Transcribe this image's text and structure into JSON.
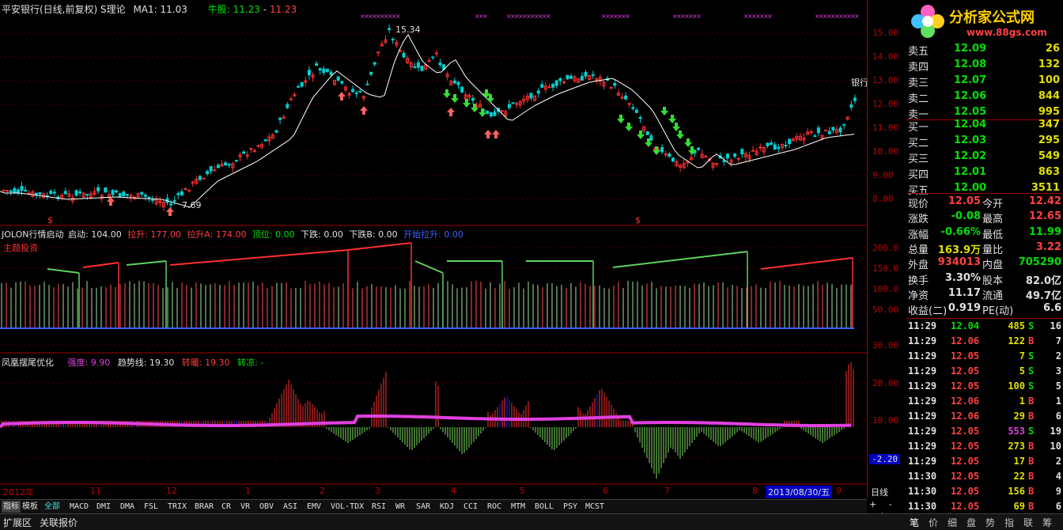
{
  "header": {
    "title": "平安银行(日线,前复权) S理论",
    "ma": "MA1: 11.03",
    "bull_label": "牛股:",
    "bull_v1": "11.23",
    "bull_v2": "11.23"
  },
  "logo": {
    "name": "分析家公式网",
    "url": "www.88gs.com"
  },
  "main_chart": {
    "axis_ticks": [
      "15.00",
      "14.00",
      "13.00",
      "12.00",
      "11.00",
      "10.00",
      "9.00",
      "8.00"
    ],
    "high_label": "15.34",
    "low_label": "7.69",
    "stock_tag": "银行",
    "marker": "$"
  },
  "indicator1": {
    "name": "JOLON行情启动",
    "f1": "启动: 104.00",
    "f2": "拉升: 177.00",
    "f3": "拉升A: 174.00",
    "f4": "顶位: 0.00",
    "f5": "下跌: 0.00",
    "f6": "下跌B: 0.00",
    "f7": "开始拉升: 0.00",
    "sub_label": "主题投资",
    "axis_ticks": [
      "200.0",
      "150.0",
      "100.0",
      "50.00"
    ]
  },
  "indicator2": {
    "name": "凤凰摆尾优化",
    "f1": "强度: 9.90",
    "f2": "趋势线: 19.30",
    "f3": "转暖: 19.30",
    "f4": "转凉: -",
    "axis_ticks": [
      "30.00",
      "20.00",
      "10.00"
    ],
    "current": "-2.20"
  },
  "time_axis": {
    "labels": [
      "2012年",
      "11",
      "12",
      "1",
      "2",
      "3",
      "4",
      "5",
      "6",
      "7",
      "8",
      "9"
    ],
    "date_highlight": "2013/08/30/五",
    "period": "日线"
  },
  "tabs": [
    "指标",
    "模板",
    "全部",
    "MACD",
    "DMI",
    "DMA",
    "FSL",
    "TRIX",
    "BRAR",
    "CR",
    "VR",
    "OBV",
    "ASI",
    "EMV",
    "VOL-TDX",
    "RSI",
    "WR",
    "SAR",
    "KDJ",
    "CCI",
    "ROC",
    "MTM",
    "BOLL",
    "PSY",
    "MCST"
  ],
  "bottom_left": [
    "扩展区",
    "关联报价"
  ],
  "bottom_right": [
    "笔",
    "价",
    "细",
    "盘",
    "势",
    "指",
    "联",
    "筹"
  ],
  "order_book": {
    "asks": [
      {
        "label": "卖五",
        "price": "12.09",
        "vol": "26"
      },
      {
        "label": "卖四",
        "price": "12.08",
        "vol": "132"
      },
      {
        "label": "卖三",
        "price": "12.07",
        "vol": "100"
      },
      {
        "label": "卖二",
        "price": "12.06",
        "vol": "844"
      },
      {
        "label": "卖一",
        "price": "12.05",
        "vol": "995"
      }
    ],
    "bids": [
      {
        "label": "买一",
        "price": "12.04",
        "vol": "347"
      },
      {
        "label": "买二",
        "price": "12.03",
        "vol": "295"
      },
      {
        "label": "买三",
        "price": "12.02",
        "vol": "549"
      },
      {
        "label": "买四",
        "price": "12.01",
        "vol": "863"
      },
      {
        "label": "买五",
        "price": "12.00",
        "vol": "3511"
      }
    ]
  },
  "quote": {
    "rows": [
      {
        "l1": "现价",
        "v1": "12.05",
        "c1": "#ff4040",
        "l2": "今开",
        "v2": "12.42",
        "c2": "#ff4040"
      },
      {
        "l1": "涨跌",
        "v1": "-0.08",
        "c1": "#00e000",
        "l2": "最高",
        "v2": "12.65",
        "c2": "#ff4040"
      },
      {
        "l1": "涨幅",
        "v1": "-0.66%",
        "c1": "#00e000",
        "l2": "最低",
        "v2": "11.99",
        "c2": "#00e000"
      },
      {
        "l1": "总量",
        "v1": "163.9万",
        "c1": "#e0e000",
        "l2": "量比",
        "v2": "3.22",
        "c2": "#ff4040"
      },
      {
        "l1": "外盘",
        "v1": "934013",
        "c1": "#ff4040",
        "l2": "内盘",
        "v2": "705290",
        "c2": "#00e000"
      },
      {
        "l1": "换手",
        "v1": "3.30%",
        "c1": "#e0e0e0",
        "l2": "股本",
        "v2": "82.0亿",
        "c2": "#e0e0e0"
      },
      {
        "l1": "净资",
        "v1": "11.17",
        "c1": "#e0e0e0",
        "l2": "流通",
        "v2": "49.7亿",
        "c2": "#e0e0e0"
      },
      {
        "l1": "收益(二)",
        "v1": "0.919",
        "c1": "#e0e0e0",
        "l2": "PE(动)",
        "v2": "6.6",
        "c2": "#e0e0e0"
      }
    ]
  },
  "ticks": [
    {
      "time": "11:29",
      "price": "12.04",
      "vol": "485",
      "bs": "S",
      "n": "16"
    },
    {
      "time": "11:29",
      "price": "12.06",
      "vol": "122",
      "bs": "B",
      "n": "7"
    },
    {
      "time": "11:29",
      "price": "12.05",
      "vol": "7",
      "bs": "S",
      "n": "2"
    },
    {
      "time": "11:29",
      "price": "12.05",
      "vol": "5",
      "bs": "S",
      "n": "3"
    },
    {
      "time": "11:29",
      "price": "12.05",
      "vol": "100",
      "bs": "S",
      "n": "5"
    },
    {
      "time": "11:29",
      "price": "12.06",
      "vol": "1",
      "bs": "B",
      "n": "1"
    },
    {
      "time": "11:29",
      "price": "12.06",
      "vol": "29",
      "bs": "B",
      "n": "6"
    },
    {
      "time": "11:29",
      "price": "12.05",
      "vol": "553",
      "bs": "S",
      "n": "19"
    },
    {
      "time": "11:29",
      "price": "12.05",
      "vol": "273",
      "bs": "B",
      "n": "10"
    },
    {
      "time": "11:29",
      "price": "12.05",
      "vol": "17",
      "bs": "B",
      "n": "2"
    },
    {
      "time": "11:30",
      "price": "12.05",
      "vol": "22",
      "bs": "B",
      "n": "4"
    },
    {
      "time": "11:30",
      "price": "12.05",
      "vol": "156",
      "bs": "B",
      "n": "9"
    },
    {
      "time": "11:30",
      "price": "12.05",
      "vol": "69",
      "bs": "B",
      "n": "6"
    }
  ],
  "colors": {
    "up": "#ff3030",
    "down": "#00d0d0",
    "ma": "#ffffff",
    "axis": "#c00000",
    "grid": "#5a0000",
    "magenta": "#e040e0"
  }
}
